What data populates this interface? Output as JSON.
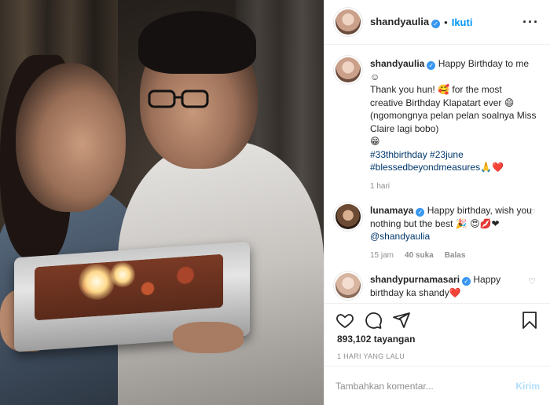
{
  "header": {
    "username": "shandyaulia",
    "separator": "•",
    "follow_label": "Ikuti",
    "more_icon": "more-dots-icon"
  },
  "caption": {
    "username": "shandyaulia",
    "line1": "Happy Birthday to me",
    "emoji1": "☺",
    "line2a": "Thank you hun!",
    "emoji2": "🥰",
    "line2b": "for the most creative Birthday Klapatart ever",
    "emoji3": "😄",
    "line3": "(ngomongnya pelan pelan soalnya Miss Claire lagi bobo)",
    "emoji4": "😁",
    "tags": "#33thbirthday #23june",
    "tags2": "#blessedbeyondmeasures",
    "emoji5": "🙏❤️",
    "time": "1 hari"
  },
  "comments": [
    {
      "username": "lunamaya",
      "text": "Happy birthday, wish you nothing but the best",
      "emoji_a": "🎉",
      "emoji_b": "😍💋❤",
      "mention": "@shandyaulia",
      "time": "15 jam",
      "likes": "40 suka",
      "reply": "Balas"
    },
    {
      "username": "shandypurnamasari",
      "text": "Happy birthday ka shandy",
      "emoji": "❤️"
    }
  ],
  "actions": {
    "like_icon": "heart-icon",
    "comment_icon": "comment-icon",
    "share_icon": "share-icon",
    "save_icon": "bookmark-icon"
  },
  "stats": {
    "views": "893,102 tayangan",
    "posted": "1 HARI YANG LALU"
  },
  "add_comment": {
    "placeholder": "Tambahkan komentar...",
    "send_label": "Kirim"
  },
  "colors": {
    "accent": "#0095f6",
    "verified": "#3897f0",
    "send_disabled": "#b2dffc",
    "muted": "#8e8e8e"
  }
}
